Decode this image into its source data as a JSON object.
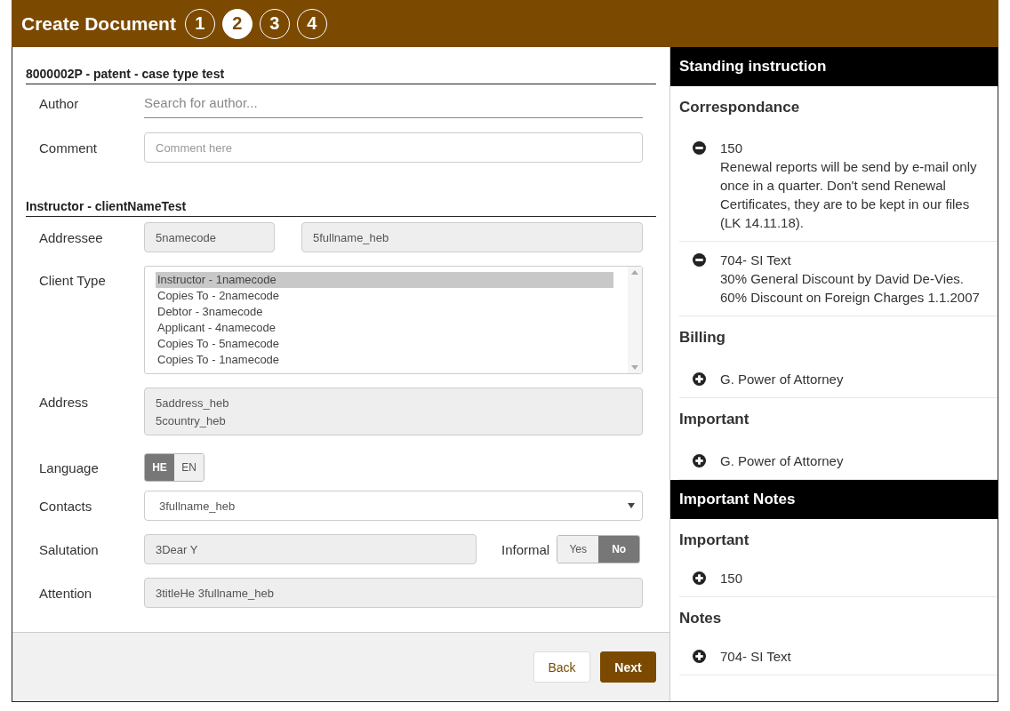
{
  "header": {
    "title": "Create Document",
    "steps": [
      {
        "label": "1",
        "selected": false
      },
      {
        "label": "2",
        "selected": true
      },
      {
        "label": "3",
        "selected": false
      },
      {
        "label": "4",
        "selected": false
      }
    ]
  },
  "case_section": {
    "title": "8000002P - patent - case type test",
    "author": {
      "label": "Author",
      "placeholder": "Search for author..."
    },
    "comment": {
      "label": "Comment",
      "placeholder": "Comment here"
    }
  },
  "instructor_section": {
    "title": "Instructor - clientNameTest",
    "addressee": {
      "label": "Addressee",
      "code": "5namecode",
      "name": "5fullname_heb"
    },
    "client_type": {
      "label": "Client Type",
      "options": [
        {
          "label": "Instructor - 1namecode",
          "selected": true
        },
        {
          "label": "Copies To - 2namecode",
          "selected": false
        },
        {
          "label": "Debtor - 3namecode",
          "selected": false
        },
        {
          "label": "Applicant - 4namecode",
          "selected": false
        },
        {
          "label": "Copies To - 5namecode",
          "selected": false
        },
        {
          "label": "Copies To - 1namecode",
          "selected": false
        }
      ]
    },
    "address": {
      "label": "Address",
      "lines": [
        "5address_heb",
        "5country_heb"
      ]
    },
    "language": {
      "label": "Language",
      "options": [
        {
          "label": "HE",
          "selected": true
        },
        {
          "label": "EN",
          "selected": false
        }
      ]
    },
    "contacts": {
      "label": "Contacts",
      "value": "3fullname_heb"
    },
    "salutation": {
      "label": "Salutation",
      "value": "3Dear Y"
    },
    "informal": {
      "label": "Informal",
      "options": [
        {
          "label": "Yes",
          "selected": false
        },
        {
          "label": "No",
          "selected": true
        }
      ]
    },
    "attention": {
      "label": "Attention",
      "value": "3titleHe 3fullname_heb"
    }
  },
  "footer": {
    "buttons": [
      {
        "label": "Back",
        "kind": "secondary"
      },
      {
        "label": "Next",
        "kind": "primary"
      }
    ]
  },
  "sidebar": {
    "panels": [
      {
        "title": "Standing instruction",
        "groups": [
          {
            "title": "Correspondance",
            "items": [
              {
                "title": "150",
                "expanded": true,
                "body": [
                  "Renewal reports will be send by e-mail only once in a quarter. Don't send Renewal Certificates, they are to be kept in our files (LK 14.11.18)."
                ]
              },
              {
                "title": "704- SI Text",
                "expanded": true,
                "body": [
                  "30% General Discount by David De-Vies.",
                  "60% Discount on Foreign Charges 1.1.2007"
                ]
              }
            ]
          },
          {
            "title": "Billing",
            "items": [
              {
                "title": "G. Power of Attorney",
                "expanded": false
              }
            ]
          },
          {
            "title": "Important",
            "items": [
              {
                "title": "G. Power of Attorney",
                "expanded": false
              }
            ]
          }
        ]
      },
      {
        "title": "Important Notes",
        "groups": [
          {
            "title": "Important",
            "items": [
              {
                "title": "150",
                "expanded": false
              }
            ]
          },
          {
            "title": "Notes",
            "items": [
              {
                "title": "704- SI Text",
                "expanded": false
              }
            ]
          }
        ]
      }
    ]
  }
}
